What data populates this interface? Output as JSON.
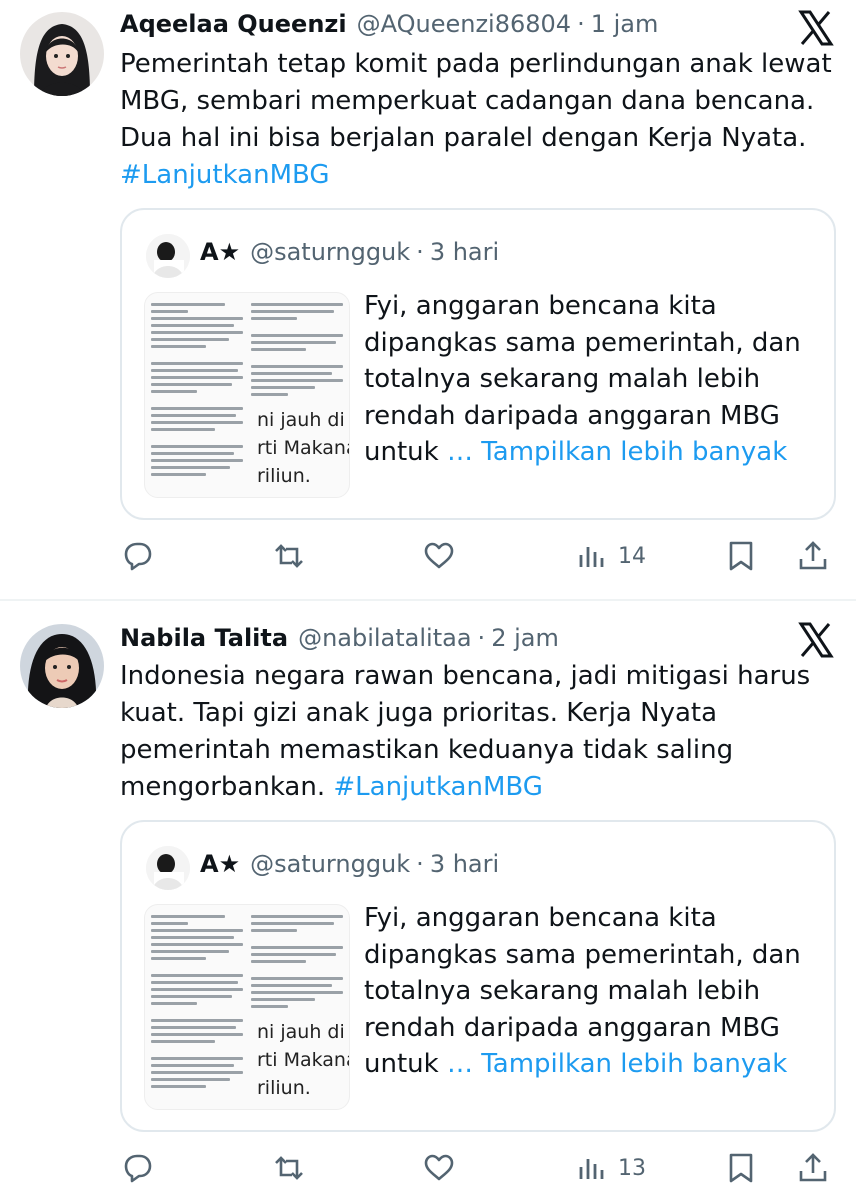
{
  "tweets": [
    {
      "author": "Aqeelaa Queenzi",
      "handle": "@AQueenzi86804",
      "separator": "·",
      "time": "1 jam",
      "text": "Pemerintah tetap komit pada perlindungan anak lewat MBG, sembari memperkuat cadangan dana bencana. Dua hal ini bisa berjalan paralel dengan Kerja Nyata.",
      "hashtag": "#LanjutkanMBG",
      "quote": {
        "author": "A★",
        "handle": "@saturngguk",
        "separator": "·",
        "time": "3 hari",
        "text": "Fyi, anggaran bencana kita dipangkas sama pemerintah, dan totalnya sekarang malah lebih rendah daripada anggaran MBG untuk",
        "more": "… Tampilkan lebih banyak",
        "thumb_lines": [
          "ni jauh di l",
          "rti Makana",
          "riliun."
        ]
      },
      "views": "14",
      "icons": [
        "reply-icon",
        "retweet-icon",
        "like-icon",
        "views-icon",
        "bookmark-icon",
        "share-icon",
        "x-logo-icon"
      ]
    },
    {
      "author": "Nabila Talita",
      "handle": "@nabilatalitaa",
      "separator": "·",
      "time": "2 jam",
      "text": "Indonesia negara rawan bencana, jadi mitigasi harus kuat. Tapi gizi anak juga prioritas. Kerja Nyata pemerintah memastikan keduanya tidak saling mengorbankan.",
      "hashtag": "#LanjutkanMBG",
      "quote": {
        "author": "A★",
        "handle": "@saturngguk",
        "separator": "·",
        "time": "3 hari",
        "text": "Fyi, anggaran bencana kita dipangkas sama pemerintah, dan totalnya sekarang malah lebih rendah daripada anggaran MBG untuk",
        "more": "… Tampilkan lebih banyak",
        "thumb_lines": [
          "ni jauh di l",
          "rti Makana",
          "riliun."
        ]
      },
      "views": "13",
      "icons": [
        "reply-icon",
        "retweet-icon",
        "like-icon",
        "views-icon",
        "bookmark-icon",
        "share-icon",
        "x-logo-icon"
      ]
    }
  ],
  "colors": {
    "text": "#0f1419",
    "muted": "#536471",
    "link": "#1d9bf0",
    "border": "#e1e8ed"
  }
}
